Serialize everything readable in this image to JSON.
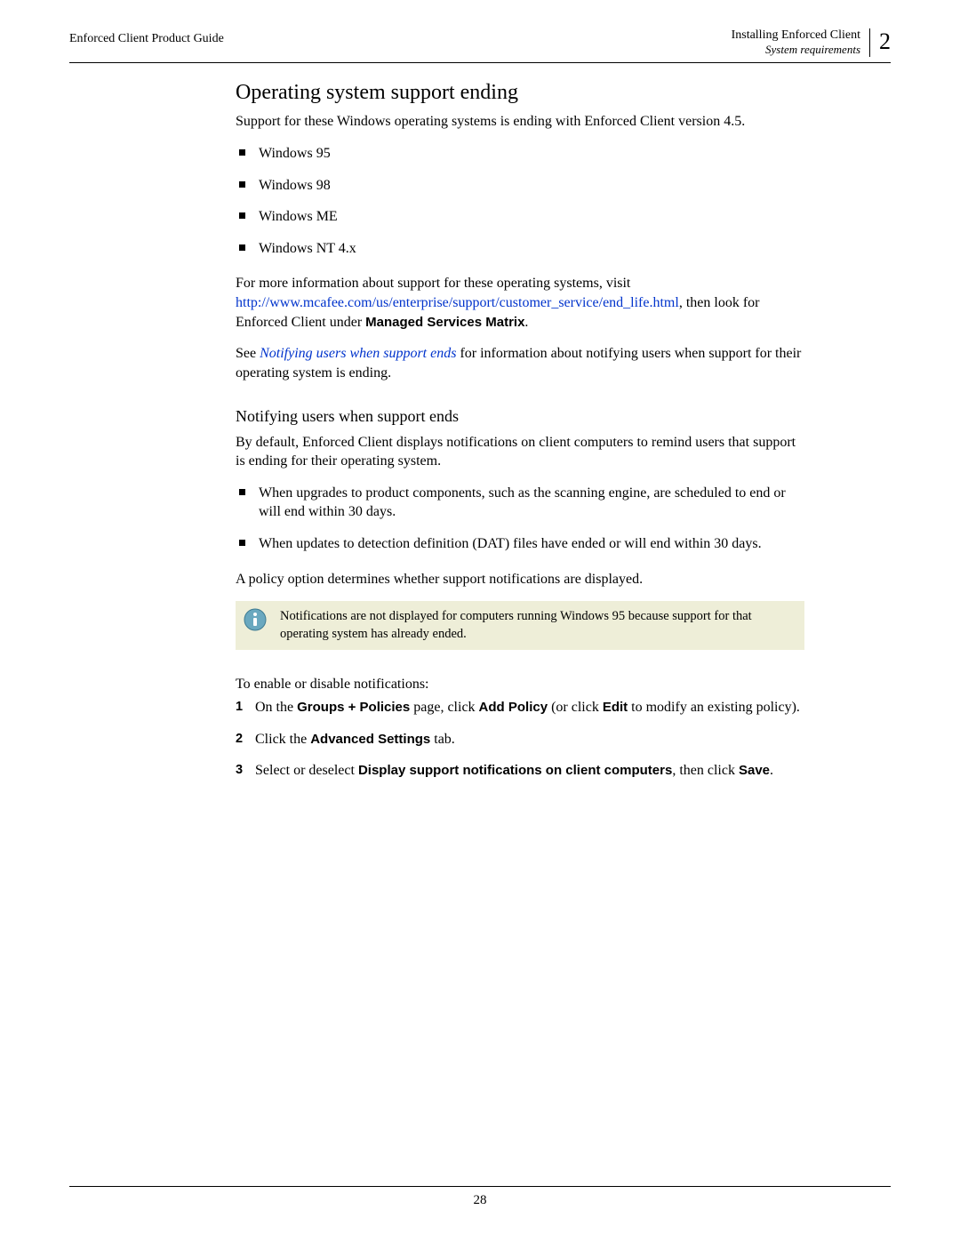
{
  "header": {
    "left": "Enforced Client Product Guide",
    "right_line1": "Installing Enforced Client",
    "right_line2": "System requirements",
    "chapter_number": "2"
  },
  "h2": "Operating system support ending",
  "intro": "Support for these Windows operating systems is ending with Enforced Client version 4.5.",
  "os_list": [
    "Windows 95",
    "Windows 98",
    "Windows ME",
    "Windows NT 4.x"
  ],
  "more_info_pre": "For more information about support for these operating systems, visit ",
  "more_info_link": "http://www.mcafee.com/us/enterprise/support/customer_service/end_life.html",
  "more_info_mid": ", then look for Enforced Client under ",
  "more_info_bold": "Managed Services Matrix",
  "more_info_post": ".",
  "see_pre": "See ",
  "see_link": "Notifying users when support ends",
  "see_post": " for information about notifying users when support for their operating system is ending.",
  "sub_heading": "Notifying users when support ends",
  "notify_intro": "By default, Enforced Client displays notifications on client computers to remind users that support is ending for their operating system.",
  "notify_bullets": [
    "When upgrades to product components, such as the scanning engine, are scheduled to end or will end within 30 days.",
    "When updates to detection definition (DAT) files have ended or will end within 30 days."
  ],
  "policy_line": "A policy option determines whether support notifications are displayed.",
  "note_text": "Notifications are not displayed for computers running Windows 95 because support for that operating system has already ended.",
  "enable_pre": "To enable or disable notifications:",
  "steps": [
    {
      "num": "1",
      "parts": [
        {
          "t": "On the "
        },
        {
          "b": "Groups + Policies"
        },
        {
          "t": " page, click "
        },
        {
          "b": "Add Policy"
        },
        {
          "t": " (or click "
        },
        {
          "b": "Edit"
        },
        {
          "t": " to modify an existing policy)."
        }
      ]
    },
    {
      "num": "2",
      "parts": [
        {
          "t": "Click the "
        },
        {
          "b": "Advanced Settings"
        },
        {
          "t": " tab."
        }
      ]
    },
    {
      "num": "3",
      "parts": [
        {
          "t": "Select or deselect "
        },
        {
          "b": "Display support notifications on client computers"
        },
        {
          "t": ", then click "
        },
        {
          "b": "Save"
        },
        {
          "t": "."
        }
      ]
    }
  ],
  "page_number": "28"
}
